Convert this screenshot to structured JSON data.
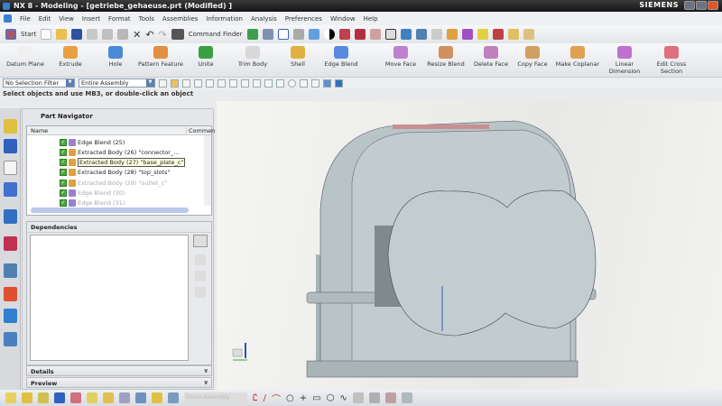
{
  "window": {
    "title": "NX 8 - Modeling - [getriebe_gehaeuse.prt (Modified) ]",
    "brand": "SIEMENS"
  },
  "menu": [
    "File",
    "Edit",
    "View",
    "Insert",
    "Format",
    "Tools",
    "Assemblies",
    "Information",
    "Analysis",
    "Preferences",
    "Window",
    "Help"
  ],
  "toolbar": {
    "start": "Start",
    "command_finder": "Command Finder"
  },
  "ribbon": [
    {
      "label": "Datum Plane",
      "color": "#f0f0f0"
    },
    {
      "label": "Extrude",
      "color": "#e8a040"
    },
    {
      "label": "Hole",
      "color": "#4a8ad8"
    },
    {
      "label": "Pattern Feature",
      "color": "#e09040"
    },
    {
      "label": "Unite",
      "color": "#3aa040"
    },
    {
      "label": "Trim Body",
      "color": "#d8d8d8"
    },
    {
      "label": "Shell",
      "color": "#e0b040"
    },
    {
      "label": "Edge Blend",
      "color": "#5a8ae0"
    },
    {
      "label": "Move Face",
      "color": "#c080d0"
    },
    {
      "label": "Resize Blend",
      "color": "#d09060"
    },
    {
      "label": "Delete Face",
      "color": "#c080c0"
    },
    {
      "label": "Copy Face",
      "color": "#d0a060"
    },
    {
      "label": "Make Coplanar",
      "color": "#e0a050"
    },
    {
      "label": "Linear Dimension",
      "color": "#c070d0"
    },
    {
      "label": "Edit Cross Section",
      "color": "#e07080"
    }
  ],
  "selection": {
    "filter": "No Selection Filter",
    "scope": "Entire Assembly"
  },
  "status": "Select objects and use MB3, or double-click an object",
  "navigator": {
    "title": "Part Navigator",
    "columns": [
      "Name",
      "Commen"
    ],
    "rows": [
      {
        "label": "Edge Blend (25)",
        "type": "blend",
        "dim": false
      },
      {
        "label": "Extracted Body (26) \"connector_...",
        "type": "extract",
        "dim": false
      },
      {
        "label": "Extracted Body (27) \"base_plate_c\"",
        "type": "extract",
        "dim": false,
        "highlight": true
      },
      {
        "label": "Extracted Body (28) \"top_slots\"",
        "type": "extract",
        "dim": false
      },
      {
        "label": "Extracted Body (29) \"outlet_c\"",
        "type": "extract",
        "dim": true
      },
      {
        "label": "Edge Blend (30)",
        "type": "blend",
        "dim": true
      },
      {
        "label": "Edge Blend (31)",
        "type": "blend",
        "dim": true
      }
    ],
    "dependencies": "Dependencies",
    "details": "Details",
    "preview": "Preview"
  },
  "bottom_toolbar": {
    "filter_label": "Entire Assembly"
  },
  "colors": {
    "accent": "#3a7fd0",
    "model": "#b7c2c4"
  }
}
